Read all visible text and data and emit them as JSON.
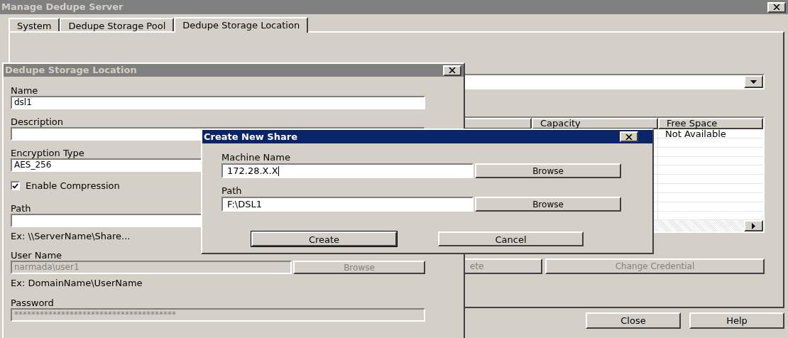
{
  "window": {
    "title": "Manage Dedupe Server"
  },
  "tabs": [
    {
      "label": "System",
      "selected": false
    },
    {
      "label": "Dedupe Storage Pool",
      "selected": false
    },
    {
      "label": "Dedupe Storage Location",
      "selected": true
    }
  ],
  "location_table": {
    "columns": [
      "Capacity",
      "Free Space"
    ],
    "rows": [
      {
        "free_space": "Not Available"
      }
    ]
  },
  "table_buttons": [
    {
      "label": "ete",
      "disabled": true
    },
    {
      "label": "Change Credential",
      "disabled": true
    }
  ],
  "footer_buttons": [
    {
      "label": "Close"
    },
    {
      "label": "Help"
    }
  ],
  "location_dialog": {
    "title": "Dedupe Storage Location",
    "items": [
      {
        "kind": "field",
        "label": "Name",
        "value": "dsl1",
        "disabled": false
      },
      {
        "kind": "field",
        "label": "Description",
        "disabled": false
      },
      {
        "kind": "field",
        "label": "Encryption Type",
        "value": "AES_256",
        "disabled": false
      },
      {
        "kind": "checkbox",
        "label": "Enable Compression",
        "checked": true
      },
      {
        "kind": "field",
        "label": "Path",
        "disabled": false,
        "hint": "Ex: \\\\ServerName\\Share..."
      },
      {
        "kind": "field",
        "label": "User Name",
        "value": "narmada\\user1",
        "disabled": true,
        "button": "Browse",
        "hint": "Ex: DomainName\\UserName"
      },
      {
        "kind": "field",
        "label": "Password",
        "value": "**************************************",
        "disabled": true
      }
    ]
  },
  "share_dialog": {
    "title": "Create New Share",
    "fields": [
      {
        "label": "Machine Name",
        "value": "172.28.X.X",
        "focused": true,
        "button": "Browse"
      },
      {
        "label": "Path",
        "value": "F:\\DSL1",
        "focused": false,
        "button": "Browse"
      }
    ],
    "buttons": [
      {
        "label": "Create",
        "default": true
      },
      {
        "label": "Cancel",
        "default": false
      }
    ]
  }
}
